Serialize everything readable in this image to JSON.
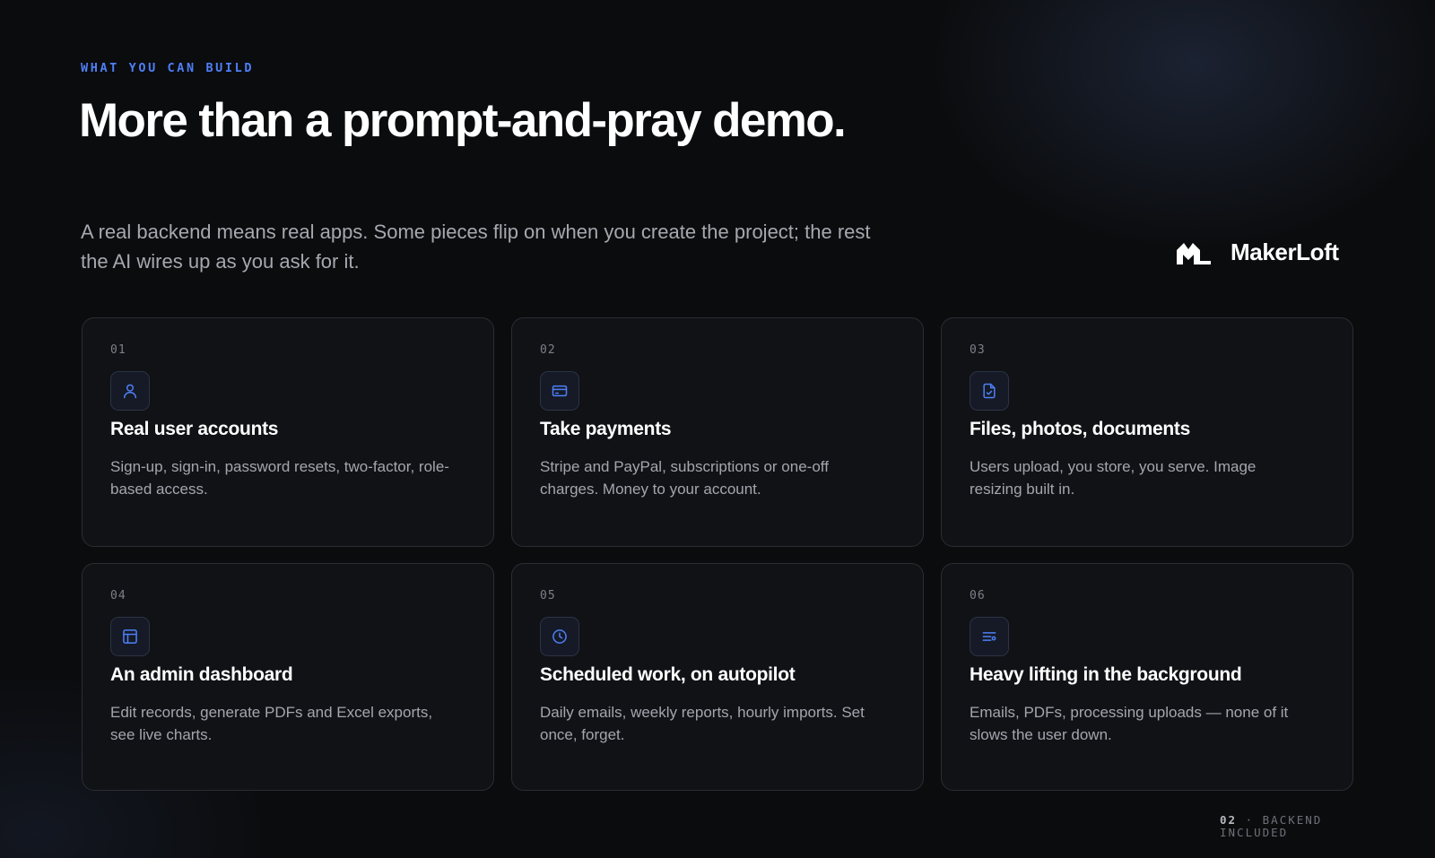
{
  "eyebrow": "WHAT YOU CAN BUILD",
  "headline": "More than a prompt-and-pray demo.",
  "intro": "A real backend means real apps. Some pieces flip on when you create the project; the rest the AI wires up as you ask for it.",
  "brand": {
    "name": "MakerLoft",
    "logo_icon": "ml-monogram-icon"
  },
  "colors": {
    "accent": "#4f7ff7",
    "background": "#0b0c0e",
    "card": "#111216",
    "card_border": "#2a2d33",
    "muted_text": "#a3a6ad"
  },
  "features": [
    {
      "number": "01",
      "icon": "user-icon",
      "title": "Real user accounts",
      "description": "Sign-up, sign-in, password resets, two-factor, role-based access."
    },
    {
      "number": "02",
      "icon": "credit-card-icon",
      "title": "Take payments",
      "description": "Stripe and PayPal, subscriptions or one-off charges. Money to your account."
    },
    {
      "number": "03",
      "icon": "file-check-icon",
      "title": "Files, photos, documents",
      "description": "Users upload, you store, you serve. Image resizing built in."
    },
    {
      "number": "04",
      "icon": "layout-panel-icon",
      "title": "An admin dashboard",
      "description": "Edit records, generate PDFs and Excel exports, see live charts."
    },
    {
      "number": "05",
      "icon": "clock-icon",
      "title": "Scheduled work, on autopilot",
      "description": "Daily emails, weekly reports, hourly imports. Set once, forget."
    },
    {
      "number": "06",
      "icon": "list-settings-icon",
      "title": "Heavy lifting in the background",
      "description": "Emails, PDFs, processing uploads — none of it slows the user down."
    }
  ],
  "footer": {
    "slide_number": "02",
    "separator": "·",
    "label": "BACKEND INCLUDED"
  }
}
